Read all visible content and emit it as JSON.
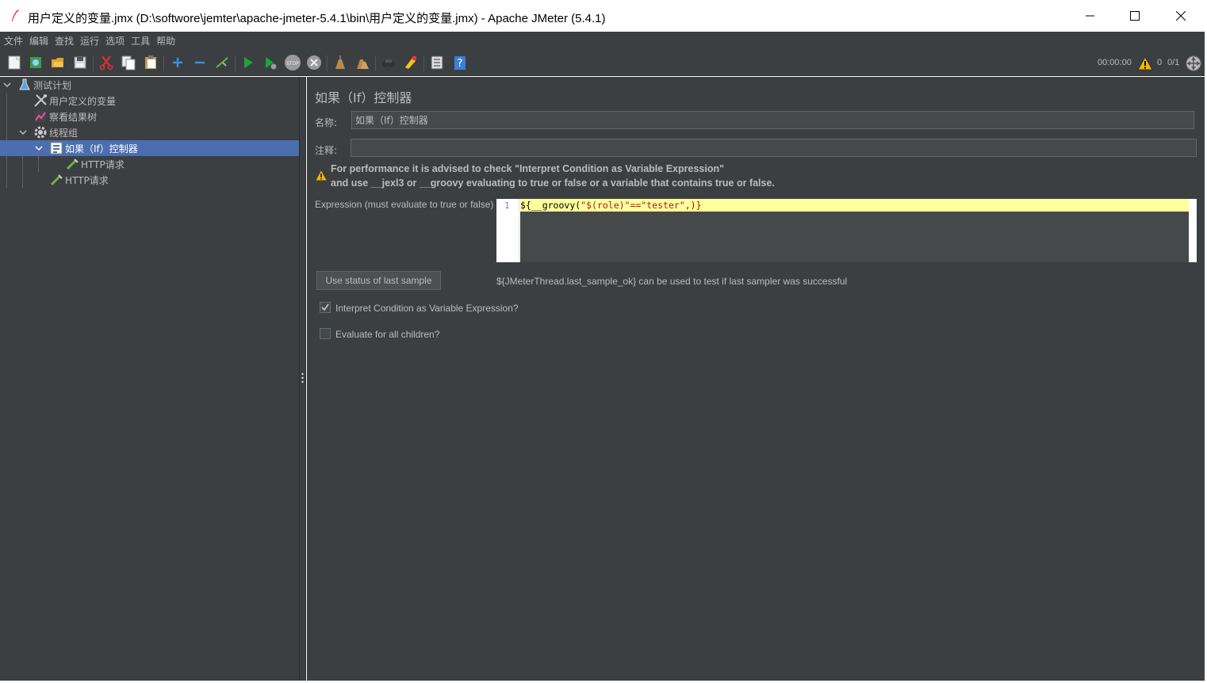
{
  "window": {
    "title": "用户定义的变量.jmx (D:\\softwore\\jemter\\apache-jmeter-5.4.1\\bin\\用户定义的变量.jmx) - Apache JMeter (5.4.1)",
    "controls": [
      "minimize-icon",
      "maximize-icon",
      "close-icon"
    ]
  },
  "menu": {
    "items": [
      "文件",
      "编辑",
      "查找",
      "运行",
      "选项",
      "工具",
      "帮助"
    ]
  },
  "toolbar": {
    "icons": [
      "new-icon",
      "templates-icon",
      "open-icon",
      "save-icon",
      "cut-icon",
      "copy-icon",
      "paste-icon",
      "expand-icon",
      "collapse-icon",
      "toggle-icon",
      "start-icon",
      "start-no-pause-icon",
      "stop-icon",
      "shutdown-icon",
      "clear-icon",
      "clear-all-icon",
      "search-icon",
      "reset-search-icon",
      "function-helper-icon",
      "help-icon"
    ],
    "elapsed": "00:00:00",
    "error_count": "0",
    "threads": "0/1"
  },
  "tree": {
    "items": [
      {
        "label": "测试计划",
        "icon": "flask-icon",
        "level": 0
      },
      {
        "label": "用户定义的变量",
        "icon": "tools-icon",
        "level": 1
      },
      {
        "label": "察看结果树",
        "icon": "chart-icon",
        "level": 1
      },
      {
        "label": "线程组",
        "icon": "gear-icon",
        "level": 1
      },
      {
        "label": "如果（If）控制器",
        "icon": "if-controller-icon",
        "level": 2,
        "selected": true
      },
      {
        "label": "HTTP请求",
        "icon": "pipette-icon",
        "level": 3
      },
      {
        "label": "HTTP请求",
        "icon": "pipette-icon",
        "level": 2
      }
    ]
  },
  "panel": {
    "title": "如果（If）控制器",
    "name_label": "名称:",
    "name_value": "如果（If）控制器",
    "comment_label": "注释:",
    "comment_value": "",
    "warning_line1": "For performance it is advised to check \"Interpret Condition as Variable Expression\"",
    "warning_line2": "and use __jexl3 or __groovy evaluating to true or false or a variable that contains true or false.",
    "expression_label": "Expression (must evaluate to true or false)",
    "expression_line_number": "1",
    "expression": {
      "open": "${",
      "fn": "__groovy(",
      "str": "\"$(role)\"==\"tester\"",
      "tail": ",)}"
    },
    "use_status_button": "Use status of last sample",
    "hint": "${JMeterThread.last_sample_ok} can be used to test if last sampler was successful",
    "interpret_checkbox": {
      "label": "Interpret Condition as Variable Expression?",
      "checked": true
    },
    "evaluate_checkbox": {
      "label": "Evaluate for all children?",
      "checked": false
    }
  },
  "colors": {
    "background": "#3c3f41",
    "selection": "#4b6eaf",
    "editor_highlight": "#ffff9b",
    "warning": "#f2b705"
  }
}
